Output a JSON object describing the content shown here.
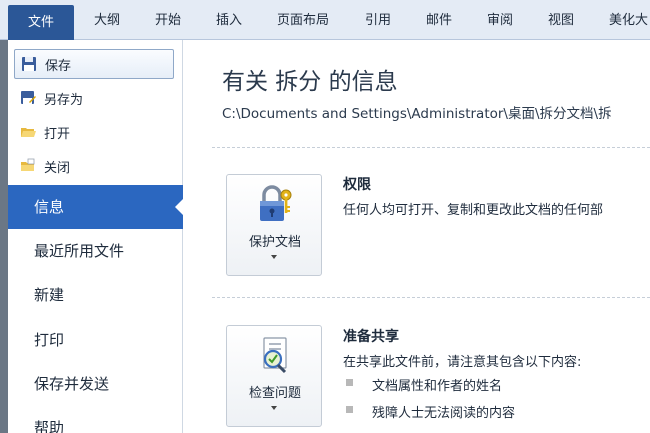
{
  "tabs": [
    {
      "label": "文件"
    },
    {
      "label": "大纲"
    },
    {
      "label": "开始"
    },
    {
      "label": "插入"
    },
    {
      "label": "页面布局"
    },
    {
      "label": "引用"
    },
    {
      "label": "邮件"
    },
    {
      "label": "审阅"
    },
    {
      "label": "视图"
    },
    {
      "label": "美化大"
    }
  ],
  "backstage": {
    "commands": [
      {
        "label": "保存",
        "icon": "save-icon"
      },
      {
        "label": "另存为",
        "icon": "save-as-icon"
      },
      {
        "label": "打开",
        "icon": "open-folder-icon"
      },
      {
        "label": "关闭",
        "icon": "close-folder-icon"
      }
    ],
    "nav": [
      {
        "label": "信息"
      },
      {
        "label": "最近所用文件"
      },
      {
        "label": "新建"
      },
      {
        "label": "打印"
      },
      {
        "label": "保存并发送"
      },
      {
        "label": "帮助"
      }
    ]
  },
  "info": {
    "title": "有关 拆分 的信息",
    "path": "C:\\Documents and Settings\\Administrator\\桌面\\拆分文档\\拆",
    "permissions": {
      "button_label": "保护文档",
      "heading": "权限",
      "text": "任何人均可打开、复制和更改此文档的任何部"
    },
    "sharing": {
      "button_label": "检查问题",
      "heading": "准备共享",
      "text": "在共享此文件前，请注意其包含以下内容:",
      "items": [
        "文档属性和作者的姓名",
        "残障人士无法阅读的内容"
      ]
    }
  },
  "colors": {
    "accent": "#2b5797",
    "nav_active": "#2b67c0"
  }
}
